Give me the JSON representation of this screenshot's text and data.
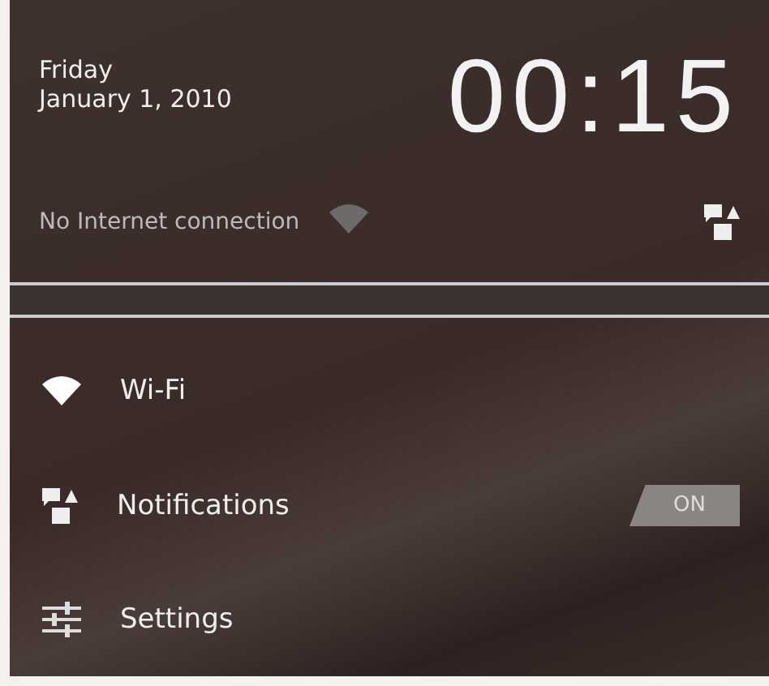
{
  "header": {
    "day": "Friday",
    "date": "January 1, 2010",
    "time": "00:15"
  },
  "status": {
    "text": "No Internet connection"
  },
  "rows": [
    {
      "kind": "link",
      "label": "Wi-Fi"
    },
    {
      "kind": "toggle",
      "label": "Notifications",
      "on": true,
      "toggle_label": "ON"
    },
    {
      "kind": "link",
      "label": "Settings"
    }
  ]
}
